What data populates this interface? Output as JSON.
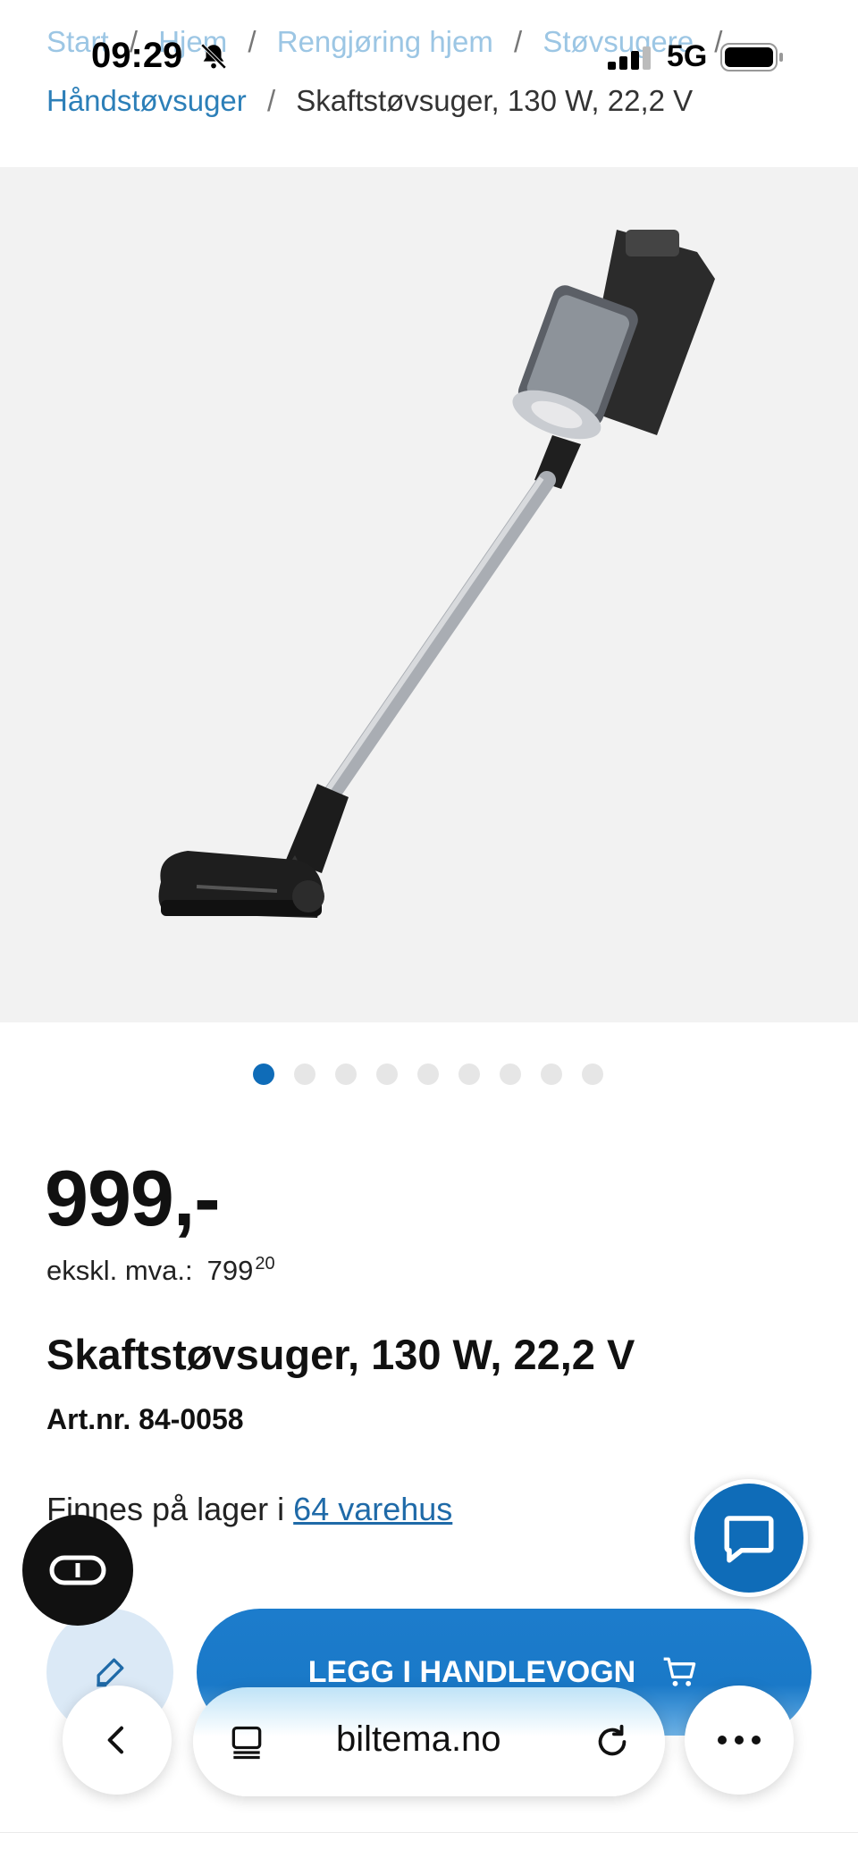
{
  "status_bar": {
    "time": "09:29",
    "network": "5G"
  },
  "breadcrumb": {
    "items": [
      "Start",
      "Hjem",
      "Rengjøring hjem",
      "Støvsugere",
      "Håndstøvsuger"
    ],
    "current": "Skaftstøvsuger, 130 W, 22,2 V",
    "separator": "/"
  },
  "gallery": {
    "image_count": 9,
    "active_index": 0
  },
  "product": {
    "price": "999,-",
    "ex_vat_label": "ekskl. mva.:",
    "ex_vat_whole": "799",
    "ex_vat_fraction": "20",
    "title": "Skaftstøvsuger, 130 W, 22,2 V",
    "article_number": "Art.nr. 84-0058",
    "stock_text": "Finnes på lager i",
    "stock_link": "64 varehus"
  },
  "actions": {
    "add_to_cart_label": "LEGG I HANDLEVOGN"
  },
  "browser": {
    "url": "biltema.no"
  },
  "colors": {
    "brand_blue": "#0f6cb8",
    "link_blue": "#2c7fb8"
  },
  "icons": {
    "bell": "bell-slash-icon",
    "signal": "signal-icon",
    "battery": "battery-icon",
    "chat": "chat-icon",
    "reader": "reader-mode-icon",
    "wishlist": "edit-list-icon",
    "cart": "cart-icon",
    "back": "chevron-left-icon",
    "tabs": "tabs-icon",
    "reload": "reload-icon",
    "more": "more-icon"
  }
}
